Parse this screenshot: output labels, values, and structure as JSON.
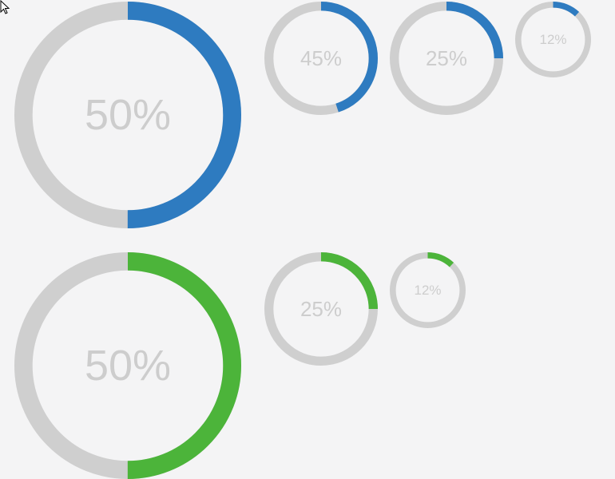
{
  "colors": {
    "track": "#cfcfcf",
    "blue": "#2e7bc0",
    "green": "#4cb43a",
    "label": "#cdcdcd",
    "background": "#f4f4f5"
  },
  "rows": [
    {
      "accent": "blue",
      "gauges": [
        {
          "label": "50%",
          "fraction": 0.5
        },
        {
          "label": "45%",
          "fraction": 0.45
        },
        {
          "label": "25%",
          "fraction": 0.25
        },
        {
          "label": "12%",
          "fraction": 0.12
        }
      ]
    },
    {
      "accent": "green",
      "gauges": [
        {
          "label": "50%",
          "fraction": 0.5
        },
        {
          "label": "25%",
          "fraction": 0.25
        },
        {
          "label": "12%",
          "fraction": 0.12
        }
      ]
    }
  ],
  "cursor_icon": "arrow-cursor-icon"
}
